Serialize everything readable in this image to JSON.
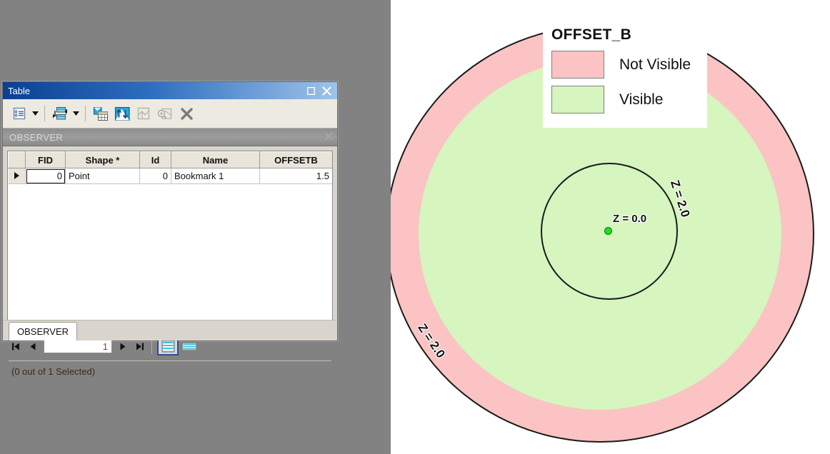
{
  "window": {
    "title": "Table",
    "maximize_icon": "maximize-icon",
    "close_icon": "close-icon",
    "tab_name": "OBSERVER",
    "tab_close_icon": "close-icon",
    "bottom_tab": "OBSERVER"
  },
  "toolbar": {
    "items": [
      {
        "name": "table-options-button",
        "icon": "list-options-icon"
      },
      {
        "name": "table-options-dropdown",
        "icon": "chevron-down-icon"
      },
      {
        "name": "related-tables-button",
        "icon": "related-tables-icon"
      },
      {
        "name": "related-tables-dropdown",
        "icon": "chevron-down-icon"
      },
      {
        "name": "select-by-attributes-button",
        "icon": "table-select-icon"
      },
      {
        "name": "switch-selection-button",
        "icon": "switch-selection-icon"
      },
      {
        "name": "zoom-to-selected-button",
        "icon": "layer-select-icon"
      },
      {
        "name": "zoom-to-selection-button",
        "icon": "zoom-selection-icon"
      },
      {
        "name": "clear-selection-button",
        "icon": "clear-selection-icon"
      }
    ]
  },
  "table": {
    "columns": [
      "",
      "FID",
      "Shape *",
      "Id",
      "Name",
      "OFFSETB"
    ],
    "rows": [
      {
        "selector": "▶",
        "FID": "0",
        "Shape": "Point",
        "Id": "0",
        "Name": "Bookmark 1",
        "OFFSETB": "1.5"
      }
    ]
  },
  "navigation": {
    "first_icon": "first-record-icon",
    "prev_icon": "previous-record-icon",
    "record_value": "1",
    "next_icon": "next-record-icon",
    "last_icon": "last-record-icon",
    "view_all_icon": "show-all-records-icon",
    "view_selected_icon": "show-selected-records-icon",
    "status": "(0 out of 1 Selected)"
  },
  "map": {
    "legend": {
      "title": "OFFSET_B",
      "entries": [
        {
          "label": "Not Visible",
          "color": "#fbc3c3"
        },
        {
          "label": "Visible",
          "color": "#d6f5bf"
        }
      ]
    },
    "labels": {
      "center": "Z = 0.0",
      "inner_ring": "Z = 2.0",
      "outer_ring": "Z = 2.0"
    },
    "observer_point_color": "#1fdf1f"
  },
  "colors": {
    "not_visible": "#fbc3c3",
    "visible": "#d6f5bf",
    "desktop": "#828282",
    "title_bar_start": "#0b3f91",
    "title_bar_end": "#9fc3ea"
  }
}
